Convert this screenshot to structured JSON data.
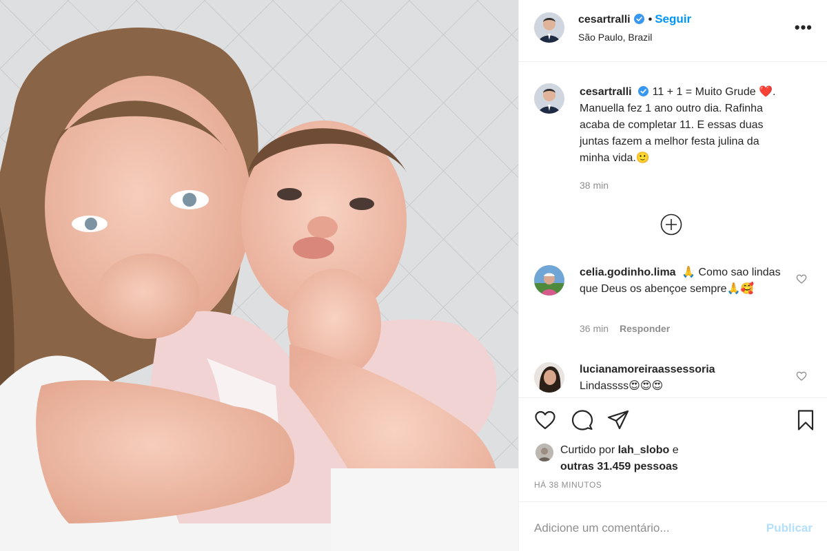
{
  "post": {
    "author": "cesartralli",
    "follow_label": "Seguir",
    "dot": "•",
    "location": "São Paulo, Brazil",
    "more_label": "•••"
  },
  "caption": {
    "author": "cesartralli",
    "text": "11 + 1 = Muito Grude ❤️. Manuella fez 1 ano outro dia. Rafinha acaba de completar 11. E essas duas juntas fazem a melhor festa julina da minha vida.🙂",
    "time": "38 min"
  },
  "comments": [
    {
      "author": "celia.godinho.lima",
      "text": "🙏 Como sao lindas que Deus os abençoe sempre🙏🥰",
      "time": "36 min",
      "reply_label": "Responder"
    },
    {
      "author": "lucianamoreiraassessoria",
      "text": "Lindassss😍😍😍"
    }
  ],
  "likes": {
    "prefix": "Curtido por",
    "user": "lah_slobo",
    "connector": "e",
    "others": "outras 31.459 pessoas"
  },
  "timestamp": "HÁ 38 MINUTOS",
  "add_comment": {
    "placeholder": "Adicione um comentário...",
    "publish_label": "Publicar"
  },
  "colors": {
    "link_blue": "#0095f6",
    "verified_blue": "#3897f0",
    "muted_gray": "#8e8e8e",
    "publish_disabled": "#b2dffc"
  }
}
